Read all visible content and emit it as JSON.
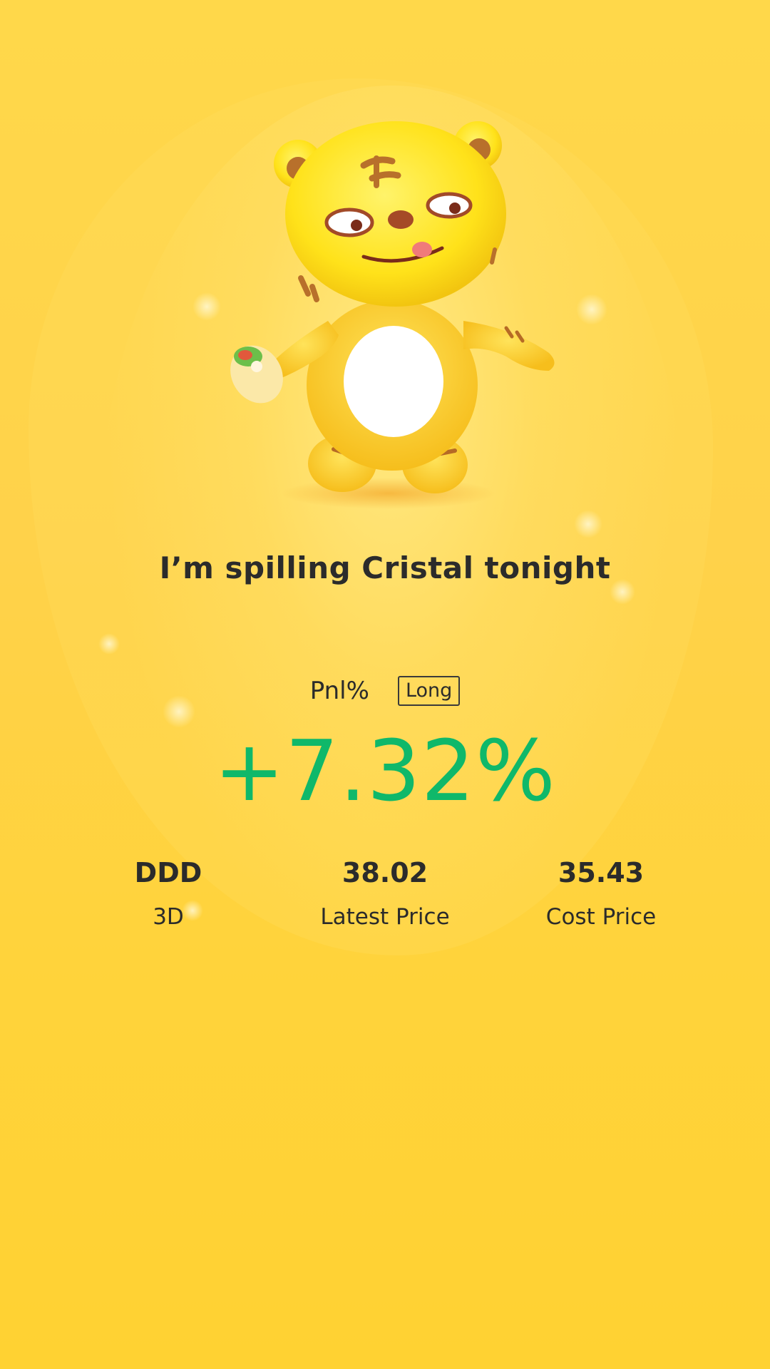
{
  "headline": "I’m spilling Cristal tonight",
  "pnl": {
    "label": "Pnl%",
    "direction_badge": "Long",
    "value": "+7.32%",
    "value_color": "#0fb86a"
  },
  "stats": [
    {
      "value": "DDD",
      "label": "3D"
    },
    {
      "value": "38.02",
      "label": "Latest Price"
    },
    {
      "value": "35.43",
      "label": "Cost Price"
    }
  ],
  "mascot": {
    "icon": "tiger-mascot-icon"
  },
  "colors": {
    "background": "#ffd54a",
    "text": "#2b2b2b",
    "positive": "#0fb86a"
  }
}
